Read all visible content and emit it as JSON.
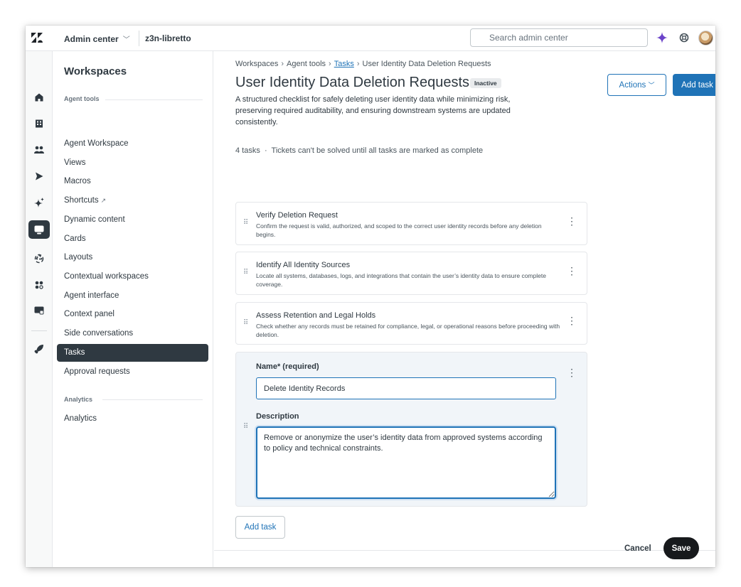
{
  "topbar": {
    "logo_icon": "zendesk-logo-icon",
    "app_title": "Admin center",
    "instance": "z3n-libretto",
    "search_placeholder": "Search admin center",
    "icons": [
      "search-icon",
      "sparkle-icon",
      "help-icon",
      "avatar"
    ]
  },
  "rail": {
    "icons": [
      "home-icon",
      "building-icon",
      "people-icon",
      "send-icon",
      "sparkle-icon",
      "workspaces-icon",
      "recycle-icon",
      "apps-icon",
      "integrations-icon",
      "rocket-icon",
      "panel-toggle-icon"
    ],
    "active": "workspaces-icon"
  },
  "sidebar": {
    "title": "Workspaces",
    "sections": [
      {
        "heading": "Agent tools"
      },
      {
        "heading": "Analytics"
      }
    ],
    "items": [
      {
        "label": "Agent Workspace"
      },
      {
        "label": "Views"
      },
      {
        "label": "Macros"
      },
      {
        "label": "Shortcuts",
        "external_icon": "↗"
      },
      {
        "label": "Dynamic content"
      },
      {
        "label": "Cards"
      },
      {
        "label": "Layouts"
      },
      {
        "label": "Contextual workspaces"
      },
      {
        "label": "Agent interface"
      },
      {
        "label": "Context panel"
      },
      {
        "label": "Side conversations"
      },
      {
        "label": "Tasks",
        "active": true
      },
      {
        "label": "Approval requests"
      },
      {
        "label": "Analytics"
      }
    ]
  },
  "main": {
    "breadcrumb": {
      "items": [
        "Workspaces",
        "Agent tools",
        "Tasks",
        "User Identity Data Deletion Requests"
      ],
      "separator": "›"
    },
    "title": "User Identity Data Deletion Requests",
    "status": "Inactive",
    "description": "A structured checklist for safely deleting user identity data while minimizing risk, preserving required auditability, and ensuring downstream systems are updated consistently.",
    "meta": "4 tasks  ·  Tickets can't be solved until all tasks are marked as complete",
    "actions_label": "Actions",
    "add_task_label": "Add task",
    "tasks": [
      {
        "title": "Verify Deletion Request",
        "description": "Confirm the request is valid, authorized, and scoped to the correct user identity records before any deletion begins."
      },
      {
        "title": "Identify All Identity Sources",
        "description": "Locate all systems, databases, logs, and integrations that contain the user’s identity data to ensure complete coverage."
      },
      {
        "title": "Assess Retention and Legal Holds",
        "description": "Check whether any records must be retained for compliance, legal, or operational reasons before proceeding with deletion."
      }
    ],
    "edit_task": {
      "name_label": "Name* (required)",
      "name_value": "Delete Identity Records",
      "description_label": "Description",
      "description_value": "Remove or anonymize the user’s identity data from approved systems according to policy and technical constraints."
    },
    "add_task_bottom_label": "Add task"
  },
  "footer": {
    "cancel_label": "Cancel",
    "save_label": "Save"
  },
  "colors": {
    "accent": "#1f73b7",
    "active_nav": "#2f3941",
    "save_button": "#17191c",
    "edit_card_bg": "#f1f5f9"
  }
}
